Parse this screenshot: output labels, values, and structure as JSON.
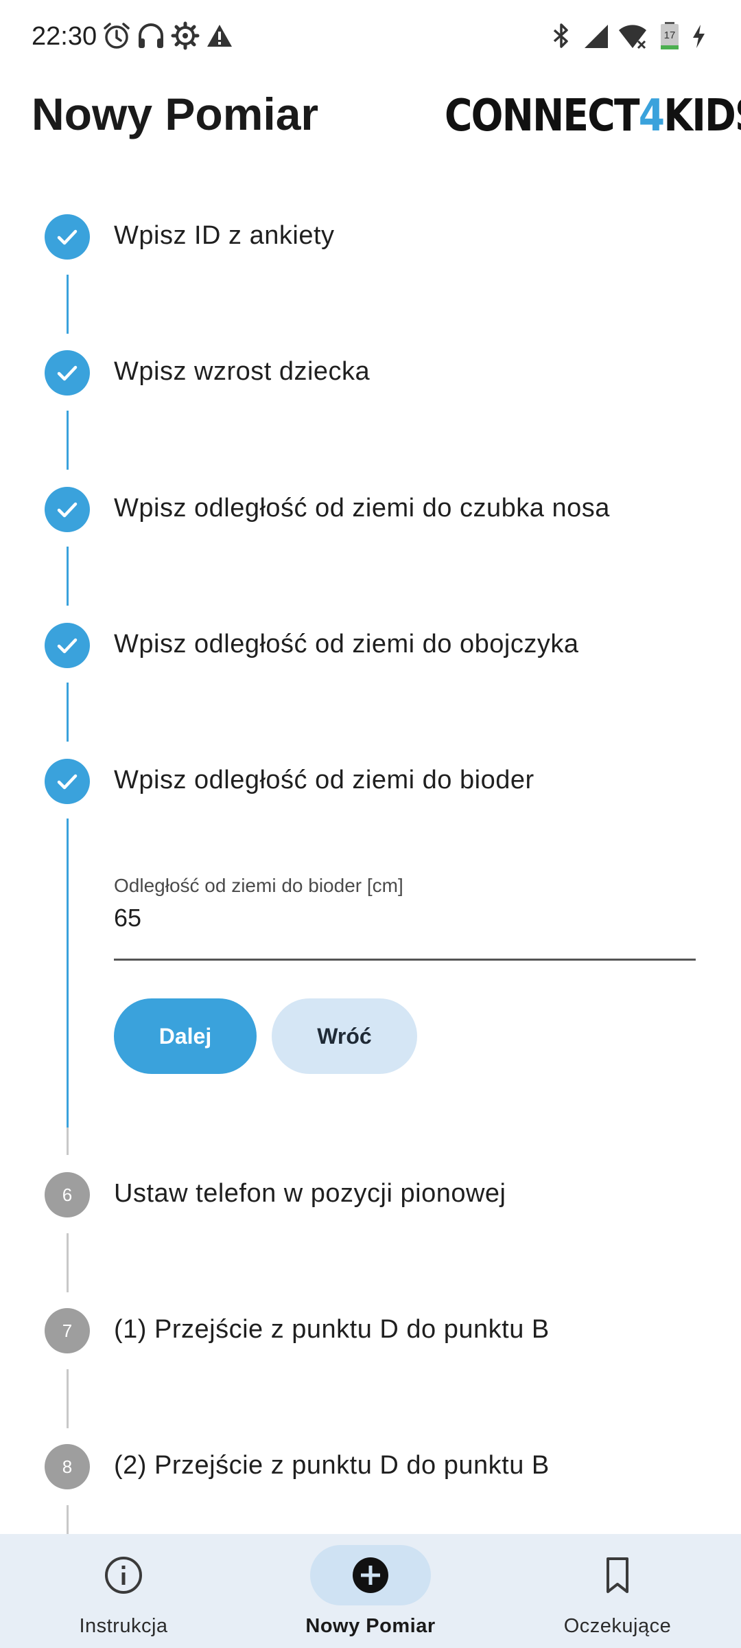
{
  "status_bar": {
    "time": "22:30",
    "battery_level": "17",
    "icons_left": [
      "alarm-icon",
      "headset-icon",
      "settings-icon",
      "warning-icon"
    ],
    "icons_right": [
      "bluetooth-icon",
      "signal-icon",
      "wifi-icon",
      "battery-icon",
      "charging-icon"
    ]
  },
  "header": {
    "title": "Nowy Pomiar",
    "logo_text_before": "CONNECT",
    "logo_text_accent": "4",
    "logo_text_after": "KIDS"
  },
  "steps": [
    {
      "label": "Wpisz ID z ankiety",
      "status": "done"
    },
    {
      "label": "Wpisz wzrost dziecka",
      "status": "done"
    },
    {
      "label": "Wpisz odległość od ziemi do czubka nosa",
      "status": "done"
    },
    {
      "label": "Wpisz odległość od ziemi do obojczyka",
      "status": "done"
    },
    {
      "label": "Wpisz odległość od ziemi do bioder",
      "status": "active"
    },
    {
      "label": "Ustaw telefon w pozycji pionowej",
      "status": "todo",
      "number": "6"
    },
    {
      "label": "(1) Przejście z punktu D do punktu B",
      "status": "todo",
      "number": "7"
    },
    {
      "label": "(2) Przejście z punktu D do punktu B",
      "status": "todo",
      "number": "8"
    }
  ],
  "active_step": {
    "field_label": "Odległość od ziemi do bioder [cm]",
    "field_value": "65",
    "next_button": "Dalej",
    "back_button": "Wróć"
  },
  "bottom_nav": {
    "items": [
      {
        "label": "Instrukcja",
        "icon": "info-icon",
        "active": false
      },
      {
        "label": "Nowy Pomiar",
        "icon": "add-circle-icon",
        "active": true
      },
      {
        "label": "Oczekujące",
        "icon": "bookmark-icon",
        "active": false
      }
    ]
  },
  "colors": {
    "accent": "#3aa2dc",
    "accent_light": "#d5e6f5",
    "inactive_step": "#9e9e9e",
    "nav_background": "#e7eef6"
  }
}
